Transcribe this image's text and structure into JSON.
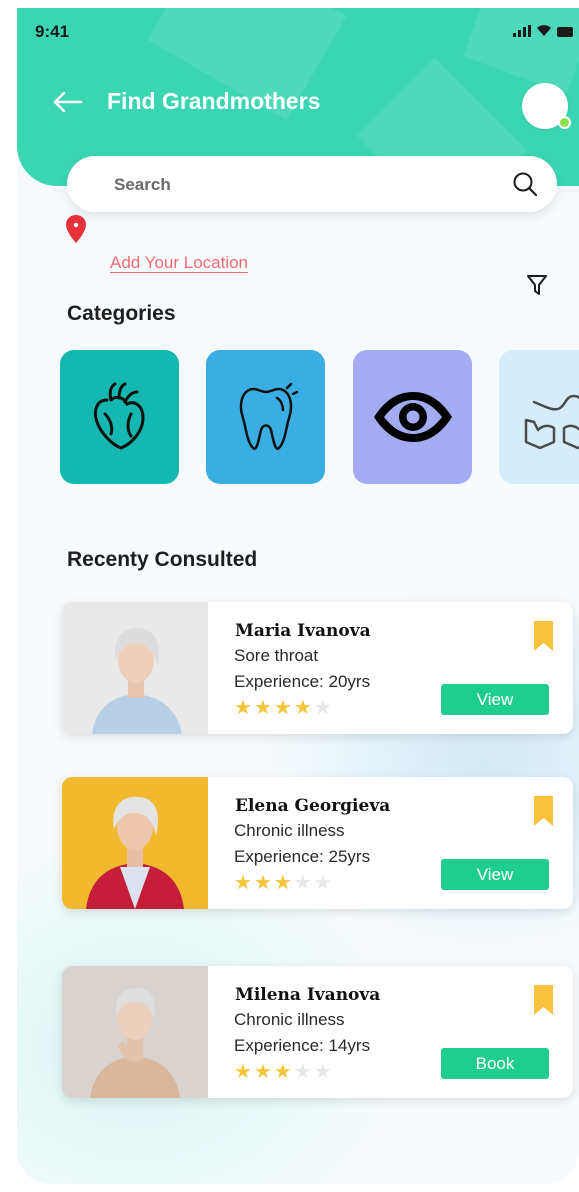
{
  "status_bar": {
    "time": "9:41"
  },
  "header": {
    "title": "Find Grandmothers"
  },
  "search": {
    "placeholder": "Search"
  },
  "location": {
    "link_label": "Add Your Location"
  },
  "categories": {
    "title": "Categories",
    "items": [
      {
        "icon": "heart-icon",
        "color": "#14b8b0"
      },
      {
        "icon": "tooth-icon",
        "color": "#3aaee3"
      },
      {
        "icon": "eye-icon",
        "color": "#a3acf2"
      },
      {
        "icon": "caring-hands-icon",
        "color": "#d4ecfb"
      }
    ]
  },
  "recent": {
    "title": "Recenty Consulted",
    "cards": [
      {
        "name": "Maria Ivanova",
        "condition": "Sore throat",
        "experience": "Experience: 20yrs",
        "rating": 4,
        "max_rating": 5,
        "action": "View"
      },
      {
        "name": "Elena Georgieva",
        "condition": "Chronic illness",
        "experience": "Experience: 25yrs",
        "rating": 3,
        "max_rating": 5,
        "action": "View"
      },
      {
        "name": "Milena Ivanova",
        "condition": "Chronic illness",
        "experience": "Experience: 14yrs",
        "rating": 3,
        "max_rating": 5,
        "action": "Book"
      }
    ]
  },
  "colors": {
    "header": "#3ad6b2",
    "accent_button": "#1fce8f",
    "link": "#ef6b74",
    "bookmark": "#f9c23c",
    "star": "#f5c53b"
  }
}
